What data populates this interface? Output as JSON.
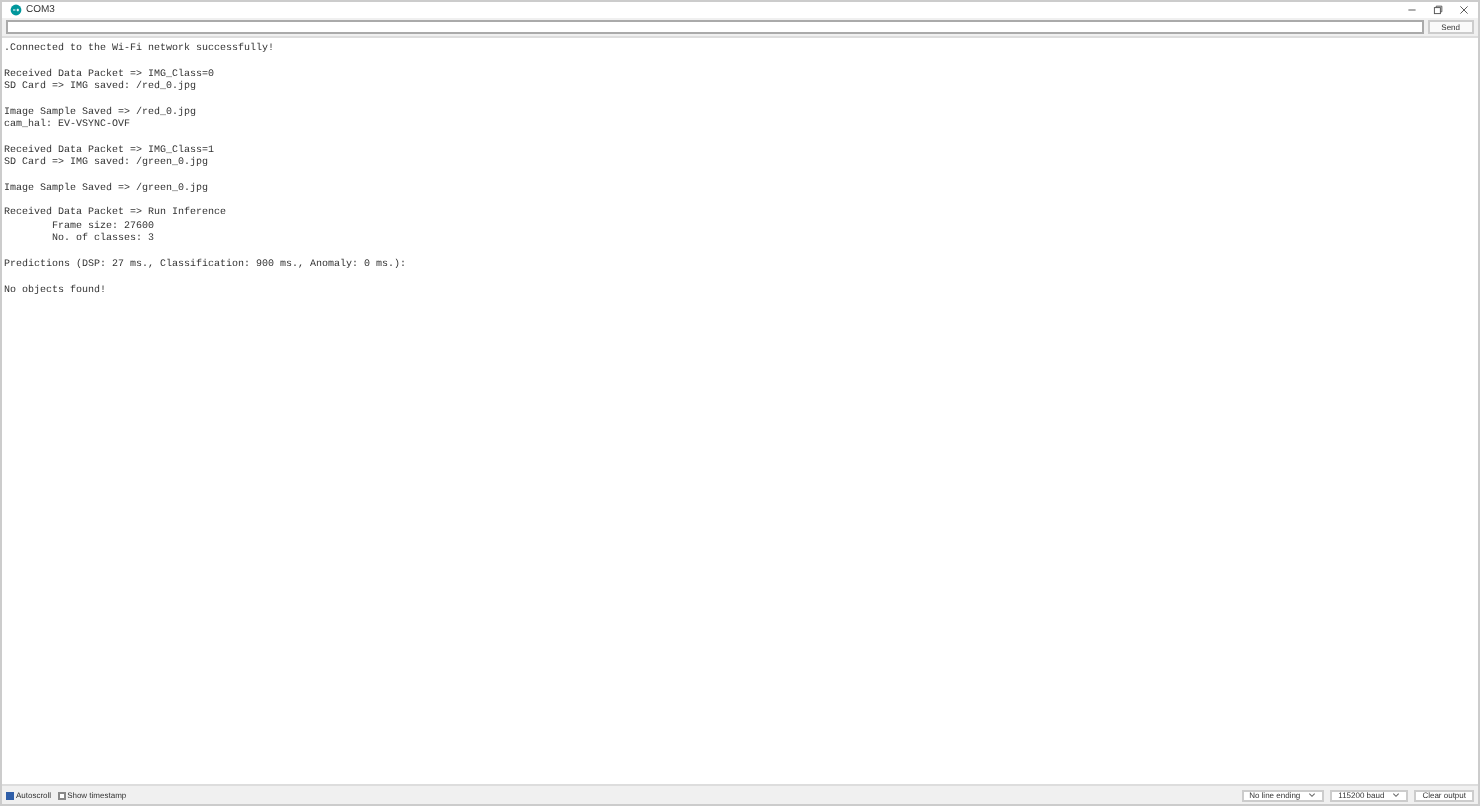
{
  "window": {
    "title": "COM3"
  },
  "input": {
    "button": "Send"
  },
  "output_blocks": [
    [
      ".Connected to the Wi-Fi network successfully!"
    ],
    [
      "Received Data Packet => IMG_Class=0",
      "SD Card => IMG saved: /red_0.jpg"
    ],
    [
      "Image Sample Saved => /red_0.jpg",
      "cam_hal: EV-VSYNC-OVF"
    ],
    [
      "Received Data Packet => IMG_Class=1",
      "SD Card => IMG saved: /green_0.jpg"
    ],
    [
      "Image Sample Saved => /green_0.jpg"
    ],
    [
      "Received Data Packet => Run Inference",
      "        Frame size: 27600",
      "        No. of classes: 3"
    ],
    [
      "Predictions (DSP: 27 ms., Classification: 900 ms., Anomaly: 0 ms.):"
    ],
    [
      "No objects found!"
    ]
  ],
  "status_bar": {
    "options": [
      {
        "label": "Autoscroll",
        "checked": true
      },
      {
        "label": "Show timestamp",
        "checked": false
      }
    ],
    "line_ending": "No line ending",
    "baud": "115200 baud",
    "clear": "Clear output"
  }
}
